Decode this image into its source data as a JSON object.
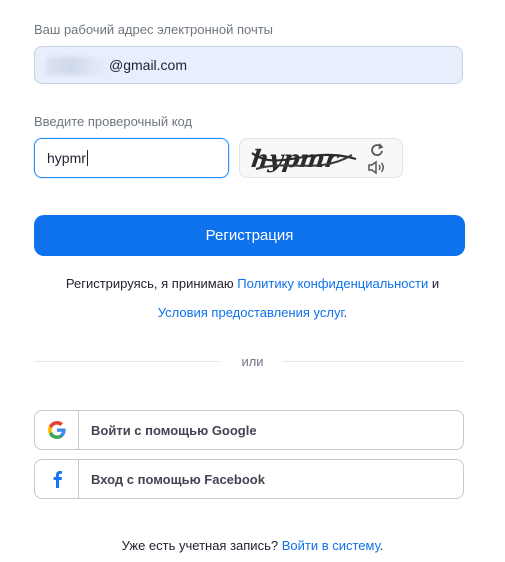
{
  "form": {
    "email_label": "Ваш рабочий адрес электронной почты",
    "email_value": "@gmail.com",
    "code_label": "Введите проверочный код",
    "code_value": "hypmr",
    "captcha_text": "hypmr",
    "register_label": "Регистрация"
  },
  "terms": {
    "prefix": "Регистрируясь, я принимаю ",
    "privacy_link": "Политику конфиденциальности",
    "conjunction": " и",
    "tos_link": "Условия предоставления услуг",
    "suffix": "."
  },
  "divider_text": "или",
  "social": {
    "google_label": "Войти с помощью Google",
    "facebook_label": "Вход с помощью Facebook"
  },
  "footer": {
    "prompt": "Уже есть учетная запись? ",
    "signin_link": "Войти в систему",
    "suffix": "."
  },
  "icons": {
    "refresh": "refresh-icon",
    "audio": "speaker-icon",
    "google": "google-icon",
    "facebook": "facebook-icon"
  },
  "colors": {
    "accent": "#0e72ed",
    "focus_border": "#2d8cff",
    "email_bg": "#e8effc"
  }
}
